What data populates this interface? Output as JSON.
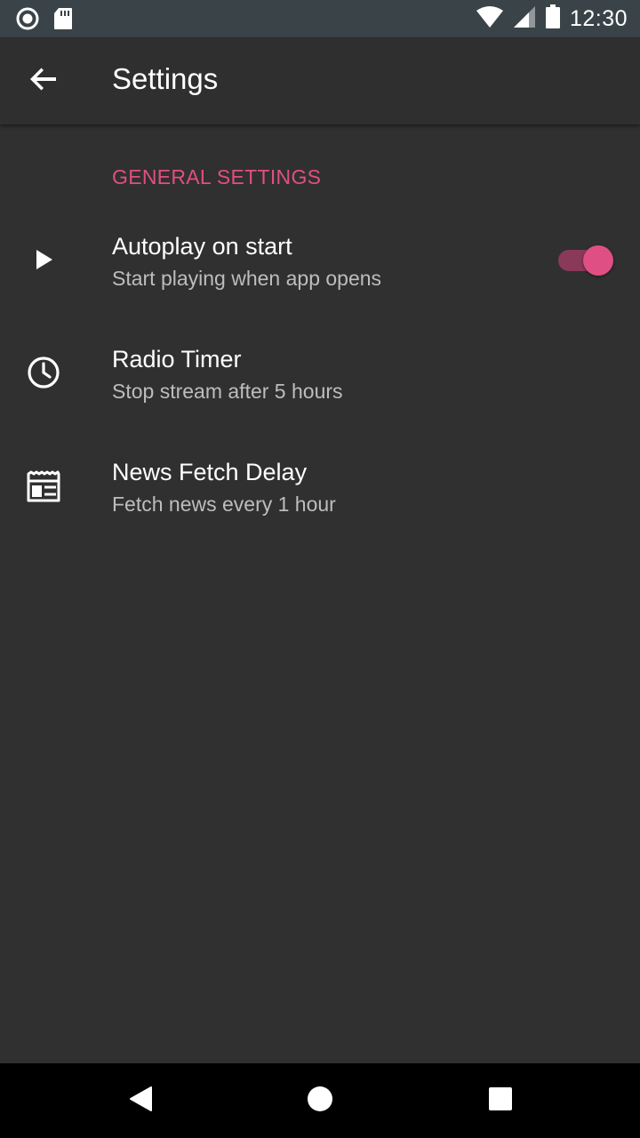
{
  "status_bar": {
    "time": "12:30",
    "left_icons": [
      "record-icon",
      "sd-card-icon"
    ],
    "right_icons": [
      "wifi-icon",
      "cell-signal-icon",
      "battery-icon"
    ]
  },
  "app_bar": {
    "title": "Settings",
    "back_icon": "arrow-back-icon"
  },
  "section": {
    "header": "GENERAL SETTINGS"
  },
  "preferences": [
    {
      "icon": "play-icon",
      "title": "Autoplay on start",
      "summary": "Start playing when app opens",
      "switch_on": true
    },
    {
      "icon": "clock-icon",
      "title": "Radio Timer",
      "summary": "Stop stream after 5 hours"
    },
    {
      "icon": "news-icon",
      "title": "News Fetch Delay",
      "summary": "Fetch news every 1 hour"
    }
  ],
  "nav_bar": {
    "buttons": [
      "back-triangle-icon",
      "home-circle-icon",
      "recents-square-icon"
    ]
  },
  "colors": {
    "accent": "#e04f83",
    "background": "#303030",
    "status_bar": "#3a4448",
    "nav_bar": "#000000"
  }
}
